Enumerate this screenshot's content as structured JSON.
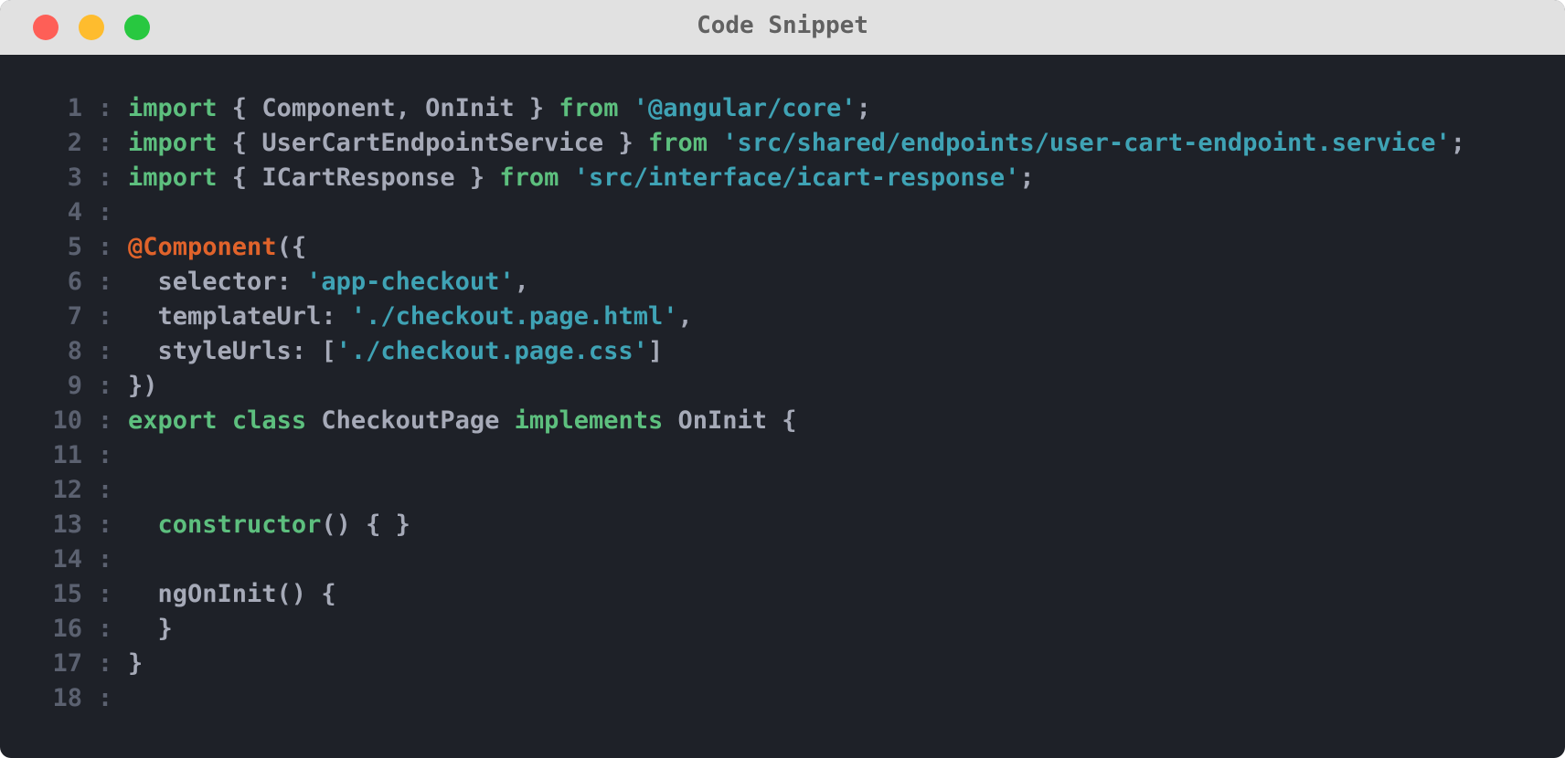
{
  "window": {
    "title": "Code Snippet"
  },
  "colors": {
    "keyword": "#5dbf7e",
    "string": "#3fa3b5",
    "decorator": "#e0632b",
    "plain": "#a6aab8",
    "line_number": "#5b6170",
    "background": "#1e2128",
    "titlebar": "#e1e1e1",
    "close": "#fe5f57",
    "minimize": "#febc2e",
    "maximize": "#28c840"
  },
  "code": {
    "separator": ":",
    "lines": [
      {
        "n": "1",
        "tokens": [
          {
            "t": "import",
            "k": "keyword"
          },
          {
            "t": " { Component, OnInit } ",
            "k": "plain"
          },
          {
            "t": "from",
            "k": "keyword"
          },
          {
            "t": " ",
            "k": "plain"
          },
          {
            "t": "'@angular/core'",
            "k": "string"
          },
          {
            "t": ";",
            "k": "plain"
          }
        ]
      },
      {
        "n": "2",
        "tokens": [
          {
            "t": "import",
            "k": "keyword"
          },
          {
            "t": " { UserCartEndpointService } ",
            "k": "plain"
          },
          {
            "t": "from",
            "k": "keyword"
          },
          {
            "t": " ",
            "k": "plain"
          },
          {
            "t": "'src/shared/endpoints/user-cart-endpoint.service'",
            "k": "string"
          },
          {
            "t": ";",
            "k": "plain"
          }
        ]
      },
      {
        "n": "3",
        "tokens": [
          {
            "t": "import",
            "k": "keyword"
          },
          {
            "t": " { ICartResponse } ",
            "k": "plain"
          },
          {
            "t": "from",
            "k": "keyword"
          },
          {
            "t": " ",
            "k": "plain"
          },
          {
            "t": "'src/interface/icart-response'",
            "k": "string"
          },
          {
            "t": ";",
            "k": "plain"
          }
        ]
      },
      {
        "n": "4",
        "tokens": []
      },
      {
        "n": "5",
        "tokens": [
          {
            "t": "@Component",
            "k": "decorator"
          },
          {
            "t": "({",
            "k": "plain"
          }
        ]
      },
      {
        "n": "6",
        "tokens": [
          {
            "t": "  selector: ",
            "k": "plain"
          },
          {
            "t": "'app-checkout'",
            "k": "string"
          },
          {
            "t": ",",
            "k": "plain"
          }
        ]
      },
      {
        "n": "7",
        "tokens": [
          {
            "t": "  templateUrl: ",
            "k": "plain"
          },
          {
            "t": "'./checkout.page.html'",
            "k": "string"
          },
          {
            "t": ",",
            "k": "plain"
          }
        ]
      },
      {
        "n": "8",
        "tokens": [
          {
            "t": "  styleUrls: [",
            "k": "plain"
          },
          {
            "t": "'./checkout.page.css'",
            "k": "string"
          },
          {
            "t": "]",
            "k": "plain"
          }
        ]
      },
      {
        "n": "9",
        "tokens": [
          {
            "t": "})",
            "k": "plain"
          }
        ]
      },
      {
        "n": "10",
        "tokens": [
          {
            "t": "export",
            "k": "keyword"
          },
          {
            "t": " ",
            "k": "plain"
          },
          {
            "t": "class",
            "k": "keyword"
          },
          {
            "t": " CheckoutPage ",
            "k": "plain"
          },
          {
            "t": "implements",
            "k": "keyword"
          },
          {
            "t": " OnInit {",
            "k": "plain"
          }
        ]
      },
      {
        "n": "11",
        "tokens": []
      },
      {
        "n": "12",
        "tokens": []
      },
      {
        "n": "13",
        "tokens": [
          {
            "t": "  ",
            "k": "plain"
          },
          {
            "t": "constructor",
            "k": "keyword"
          },
          {
            "t": "() { }",
            "k": "plain"
          }
        ]
      },
      {
        "n": "14",
        "tokens": []
      },
      {
        "n": "15",
        "tokens": [
          {
            "t": "  ngOnInit() {",
            "k": "plain"
          }
        ]
      },
      {
        "n": "16",
        "tokens": [
          {
            "t": "  }",
            "k": "plain"
          }
        ]
      },
      {
        "n": "17",
        "tokens": [
          {
            "t": "}",
            "k": "plain"
          }
        ]
      },
      {
        "n": "18",
        "tokens": []
      }
    ]
  }
}
